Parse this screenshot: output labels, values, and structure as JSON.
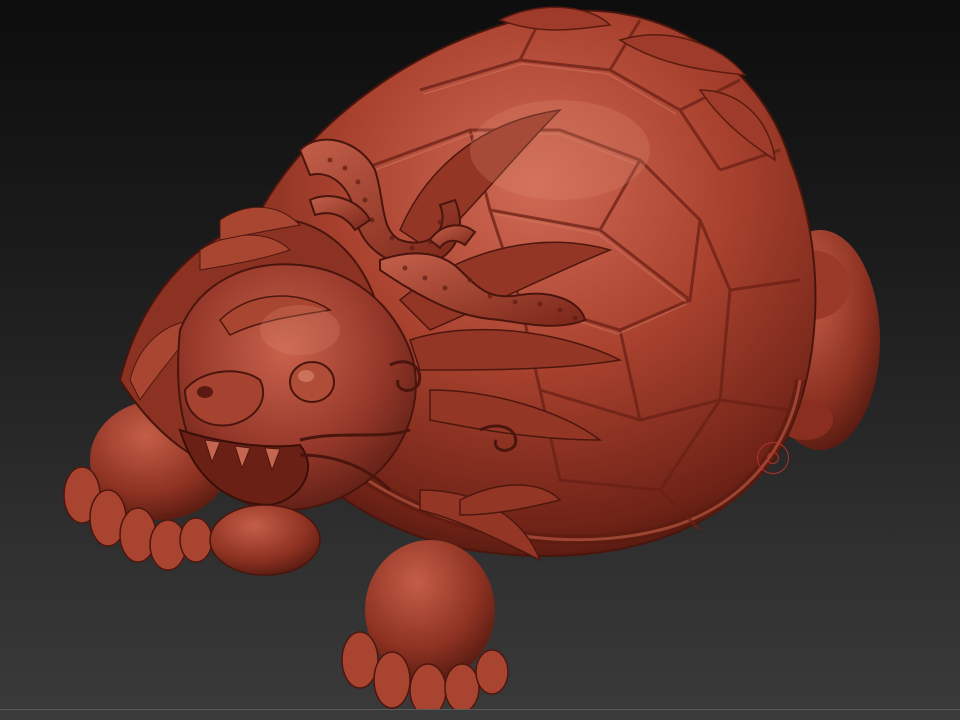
{
  "viewport": {
    "background_top": "#0d0d0d",
    "background_bottom": "#3a3a3a"
  },
  "model": {
    "subject": "dragon-turtle-sculpt",
    "material_color": "#a8412e",
    "highlight_color": "#d8705a",
    "shadow_color": "#4a150d"
  },
  "brush_cursor": {
    "icon": "brush-circle-icon",
    "color": "#b3322a"
  }
}
